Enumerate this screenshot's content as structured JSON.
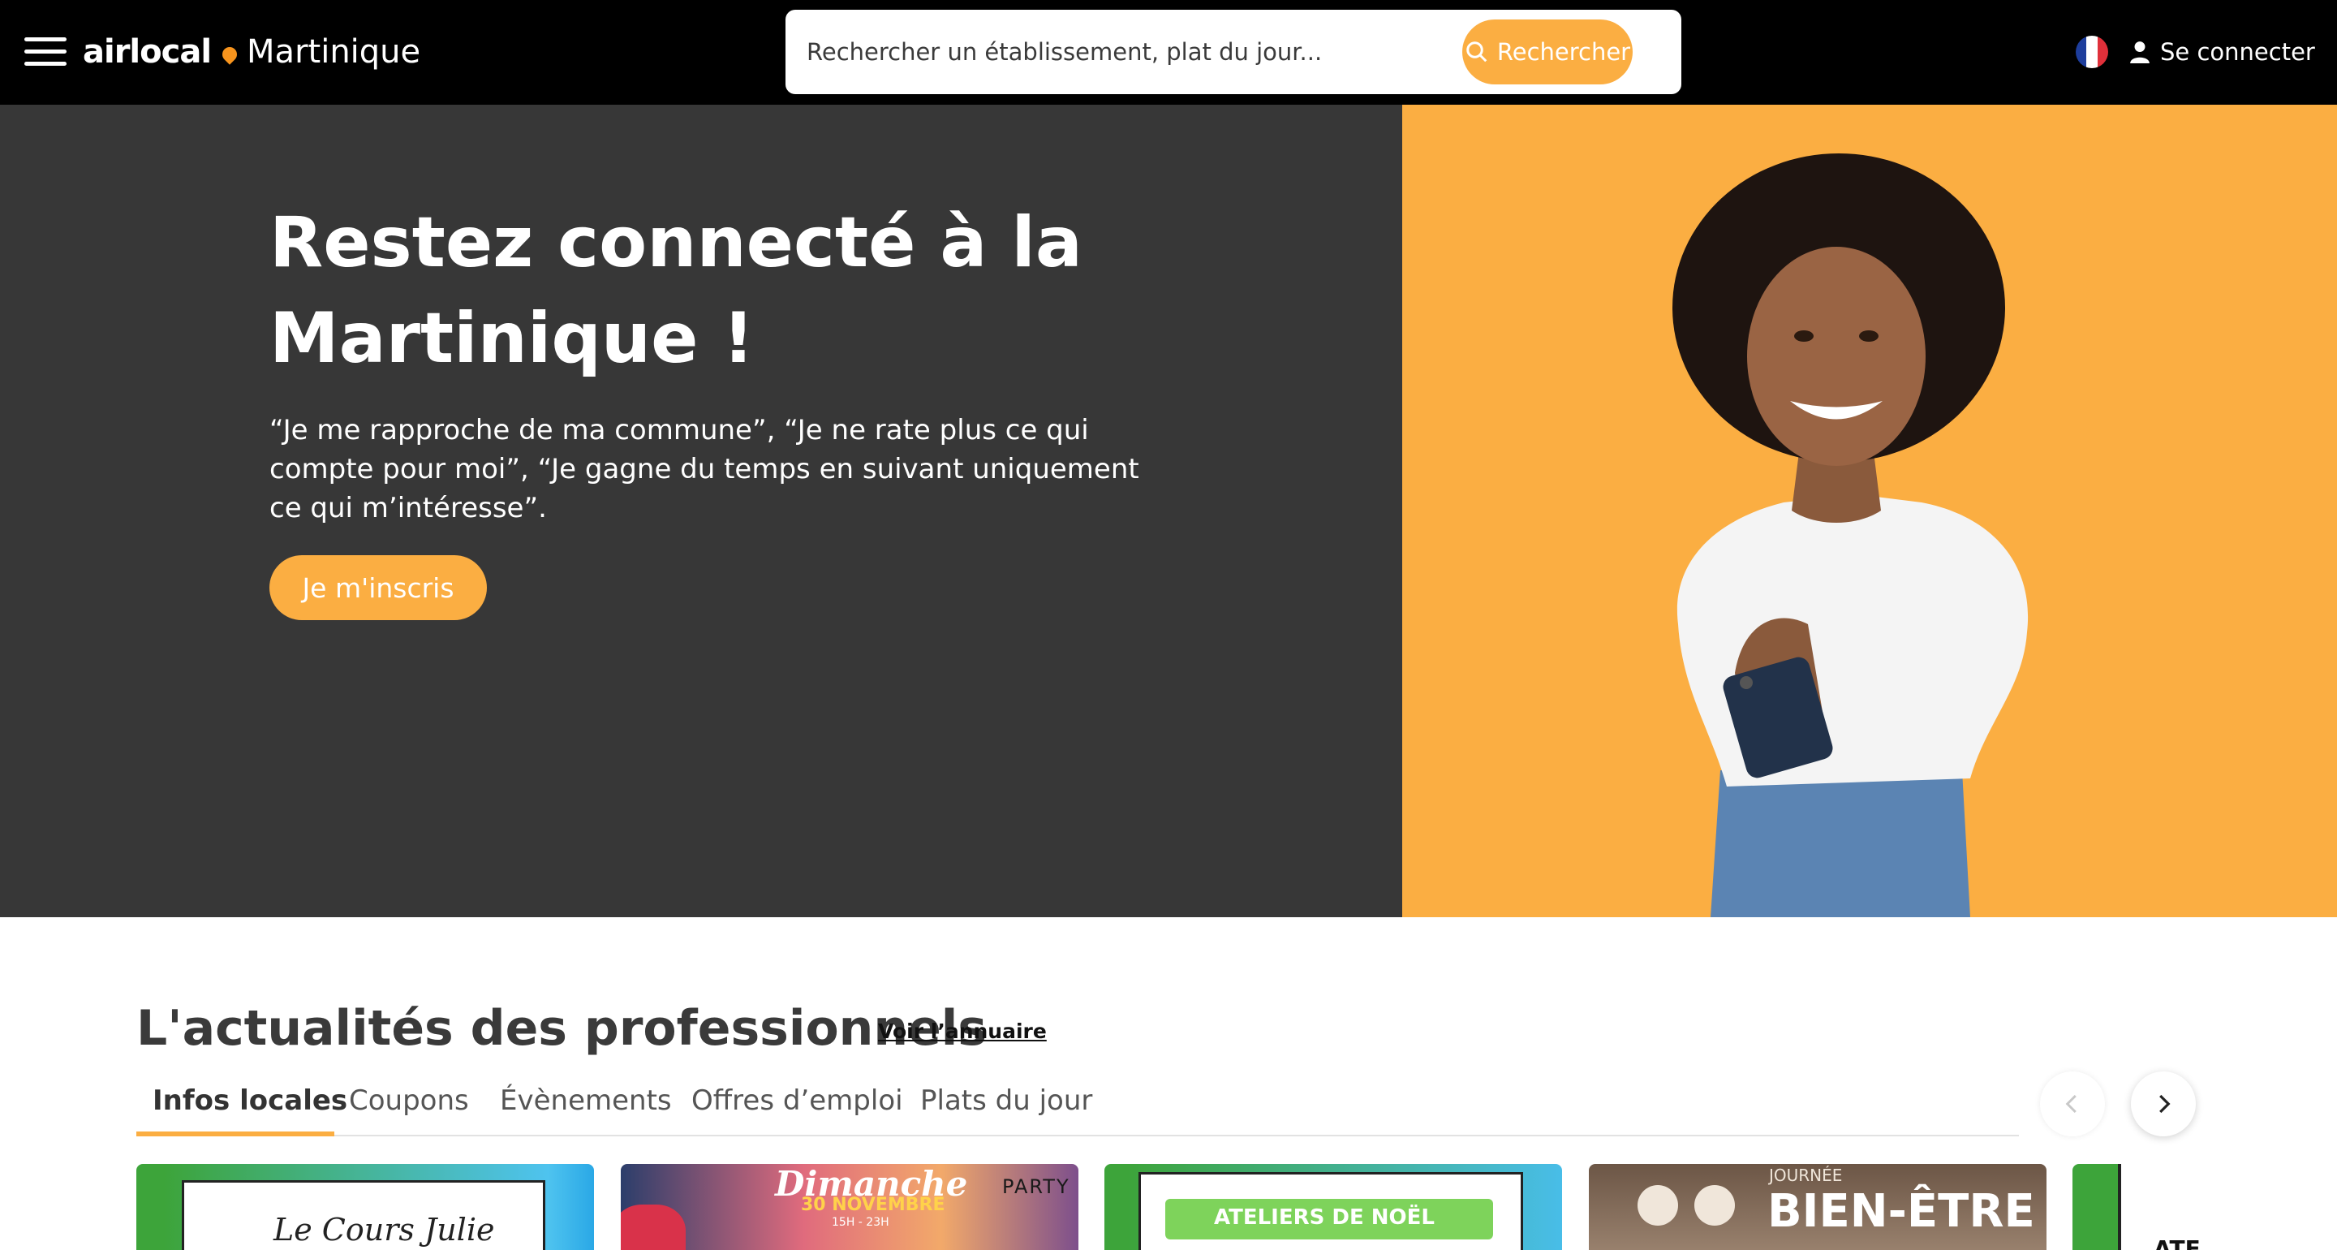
{
  "header": {
    "logo_brand": "airlocal",
    "logo_region": "Martinique",
    "search": {
      "placeholder": "Rechercher un établissement, plat du jour...",
      "button_label": "Rechercher"
    },
    "language_icon": "flag-fr-icon",
    "login_label": "Se connecter"
  },
  "hero": {
    "title": "Restez connecté à la Martinique !",
    "quote": "“Je me rapproche de ma commune”, “Je ne rate plus ce qui compte pour moi”, “Je gagne du temps en suivant uniquement ce qui m’intéresse”.",
    "cta_label": "Je m'inscris",
    "image_icon": "smiling-woman-with-phone-photo"
  },
  "news": {
    "title": "L'actualités des professionnels",
    "directory_link": "Voir l’annuaire",
    "tabs": [
      {
        "label": "Infos locales",
        "active": true
      },
      {
        "label": "Coupons",
        "active": false
      },
      {
        "label": "Évènements",
        "active": false
      },
      {
        "label": "Offres d’emploi",
        "active": false
      },
      {
        "label": "Plats du jour",
        "active": false
      }
    ],
    "cards": [
      {
        "text": "Le Cours Julie"
      },
      {
        "text": "Dimanche",
        "subtext": "30 NOVEMBRE",
        "time": "15H - 23H",
        "badge": "PARTY"
      },
      {
        "text": "ATELIERS DE NOËL"
      },
      {
        "text": "BIEN-ÊTRE",
        "subtext": "JOURNÉE"
      },
      {
        "text": "ATEL"
      }
    ]
  },
  "colors": {
    "accent": "#fbae42",
    "header_bg": "#000000",
    "hero_dark": "#373737",
    "text_dark": "#3a3a3a"
  }
}
